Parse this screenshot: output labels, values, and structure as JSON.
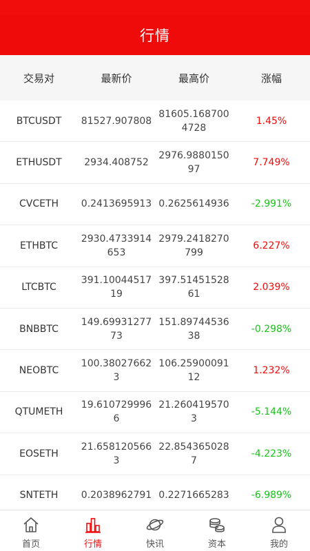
{
  "header": {
    "title": "行情"
  },
  "columns": {
    "pair": "交易对",
    "latest": "最新价",
    "high": "最高价",
    "change": "涨幅"
  },
  "rows": [
    {
      "pair": "BTCUSDT",
      "latest": "81527.907808",
      "high": "81605.1687004728",
      "change": "1.45%",
      "trend": "up"
    },
    {
      "pair": "ETHUSDT",
      "latest": "2934.408752",
      "high": "2976.988015097",
      "change": "7.749%",
      "trend": "up"
    },
    {
      "pair": "CVCETH",
      "latest": "0.2413695913",
      "high": "0.2625614936",
      "change": "-2.991%",
      "trend": "down"
    },
    {
      "pair": "ETHBTC",
      "latest": "2930.4733914653",
      "high": "2979.2418270799",
      "change": "6.227%",
      "trend": "up"
    },
    {
      "pair": "LTCBTC",
      "latest": "391.1004451719",
      "high": "397.5145152861",
      "change": "2.039%",
      "trend": "up"
    },
    {
      "pair": "BNBBTC",
      "latest": "149.6993127773",
      "high": "151.8974453638",
      "change": "-0.298%",
      "trend": "down"
    },
    {
      "pair": "NEOBTC",
      "latest": "100.380276623",
      "high": "106.2590009112",
      "change": "1.232%",
      "trend": "up"
    },
    {
      "pair": "QTUMETH",
      "latest": "19.6107299966",
      "high": "21.2604195703",
      "change": "-5.144%",
      "trend": "down"
    },
    {
      "pair": "EOSETH",
      "latest": "21.6581205663",
      "high": "22.8543650287",
      "change": "-4.223%",
      "trend": "down"
    },
    {
      "pair": "SNTETH",
      "latest": "0.2038962791",
      "high": "0.2271665283",
      "change": "-6.989%",
      "trend": "down"
    }
  ],
  "tabbar": {
    "items": [
      {
        "label": "首页",
        "icon": "home-icon"
      },
      {
        "label": "行情",
        "icon": "bar-chart-icon",
        "active": true
      },
      {
        "label": "快讯",
        "icon": "planet-icon"
      },
      {
        "label": "资本",
        "icon": "coins-icon"
      },
      {
        "label": "我的",
        "icon": "user-icon"
      }
    ]
  },
  "colors": {
    "brand": "#f00b0b",
    "up": "#f20a0a",
    "down": "#16c417"
  }
}
